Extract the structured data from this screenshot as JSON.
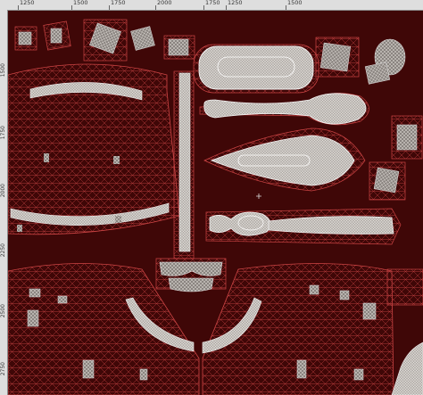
{
  "rulers": {
    "horizontal": [
      "1250",
      "1500",
      "1750",
      "2000",
      "1750",
      "1250",
      "1500"
    ],
    "vertical": [
      "1500",
      "1750",
      "2000",
      "2250",
      "2500",
      "2750"
    ]
  },
  "colors": {
    "ruler_bg": "#dedede",
    "canvas_bg": "#3f0707",
    "wire_red": "#b23a3a",
    "wire_white": "#d9d4cf"
  },
  "cursor": "crosshair-icon"
}
